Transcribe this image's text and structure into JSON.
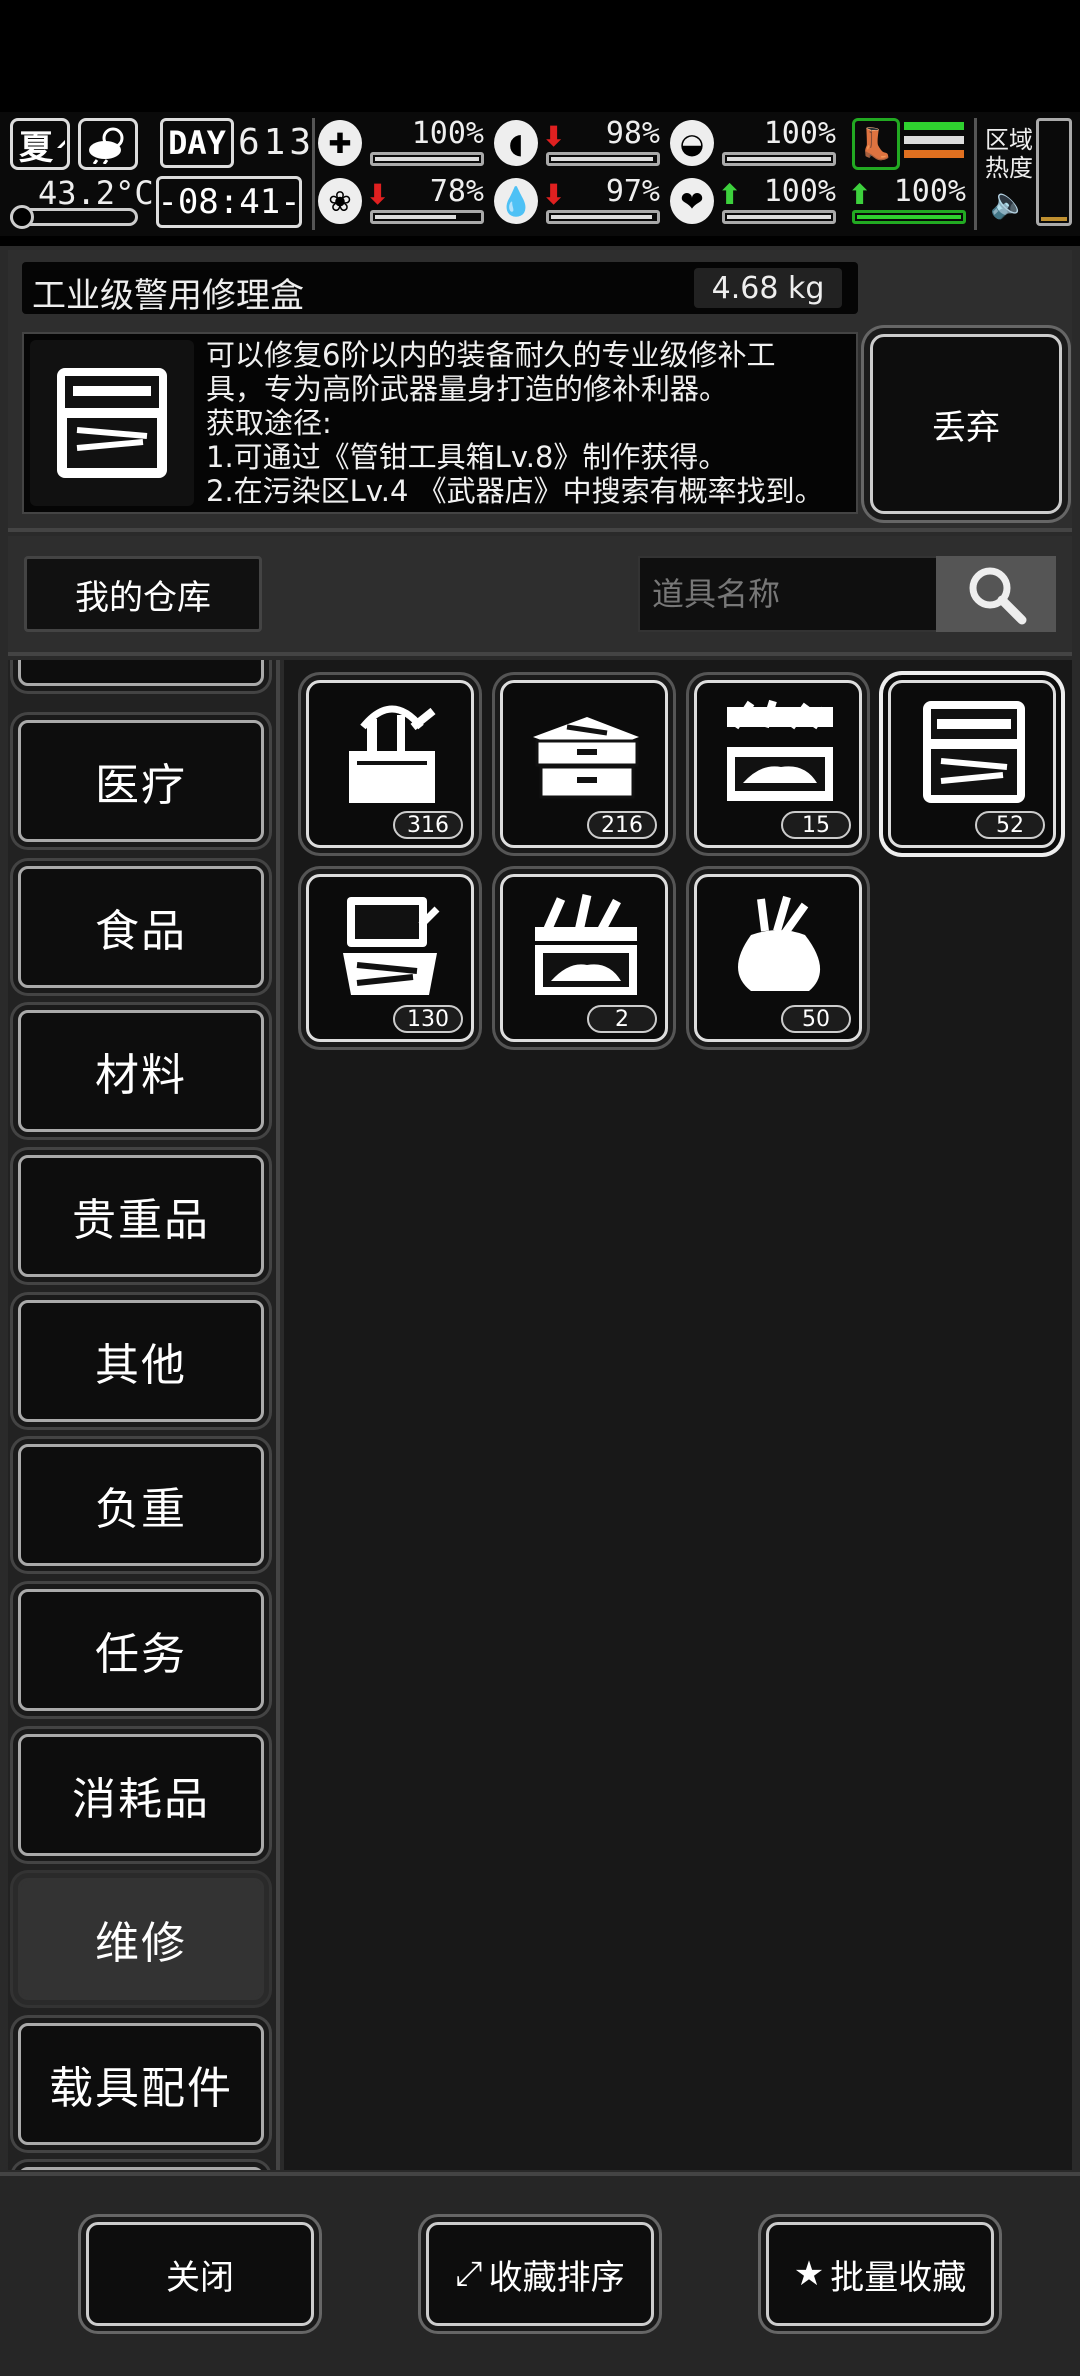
{
  "status": {
    "season": "夏",
    "temperature": "43.2°C",
    "day_label": "DAY",
    "day_number": "613",
    "clock": "-08:41-",
    "stats": [
      {
        "name": "health",
        "icon": "medkit-icon",
        "value": "100%",
        "arrow": "",
        "fill": 1.0
      },
      {
        "name": "hunger",
        "icon": "stomach-icon",
        "value": "98%",
        "arrow": "down",
        "fill": 0.98
      },
      {
        "name": "stamina",
        "icon": "shield-icon",
        "value": "100%",
        "arrow": "",
        "fill": 1.0
      },
      {
        "name": "mood",
        "icon": "brain-icon",
        "value": "78%",
        "arrow": "down",
        "fill": 0.78
      },
      {
        "name": "thirst",
        "icon": "water-drop-icon",
        "value": "97%",
        "arrow": "down",
        "fill": 0.97
      },
      {
        "name": "heart",
        "icon": "heart-icon",
        "value": "100%",
        "arrow": "up",
        "fill": 1.0
      }
    ],
    "boot_value": "100%",
    "zone_label_1": "区域",
    "zone_label_2": "热度"
  },
  "item": {
    "name": "工业级警用修理盒",
    "weight": "4.68 kg",
    "description_lines": [
      "可以修复6阶以内的装备耐久的专业级修补工",
      "具，专为高阶武器量身打造的修补利器。",
      "获取途径:",
      "1.可通过《管钳工具箱Lv.8》制作获得。",
      "2.在污染区Lv.4 《武器店》中搜索有概率找到。"
    ],
    "discard_label": "丢弃"
  },
  "warehouse": {
    "label": "我的仓库",
    "search_placeholder": "道具名称"
  },
  "categories": [
    "医疗",
    "食品",
    "材料",
    "贵重品",
    "其他",
    "负重",
    "任务",
    "消耗品",
    "维修",
    "载具配件"
  ],
  "active_category": "维修",
  "items": [
    {
      "icon": "tool-bag-icon",
      "count": "316"
    },
    {
      "icon": "cantilever-toolbox-icon",
      "count": "216"
    },
    {
      "icon": "vehicle-toolbox-icon",
      "count": "15"
    },
    {
      "icon": "repair-case-icon",
      "count": "52",
      "selected": true
    },
    {
      "icon": "pliers-case-icon",
      "count": "130"
    },
    {
      "icon": "car-repair-kit-icon",
      "count": "2"
    },
    {
      "icon": "tool-pouch-icon",
      "count": "50"
    }
  ],
  "bottom": {
    "close_label": "关闭",
    "sort_label": "收藏排序",
    "batch_label": "批量收藏"
  },
  "colors": {
    "arrow_up": "#3dd13d",
    "arrow_down": "#e02020",
    "boot_green": "#2fd12f"
  }
}
